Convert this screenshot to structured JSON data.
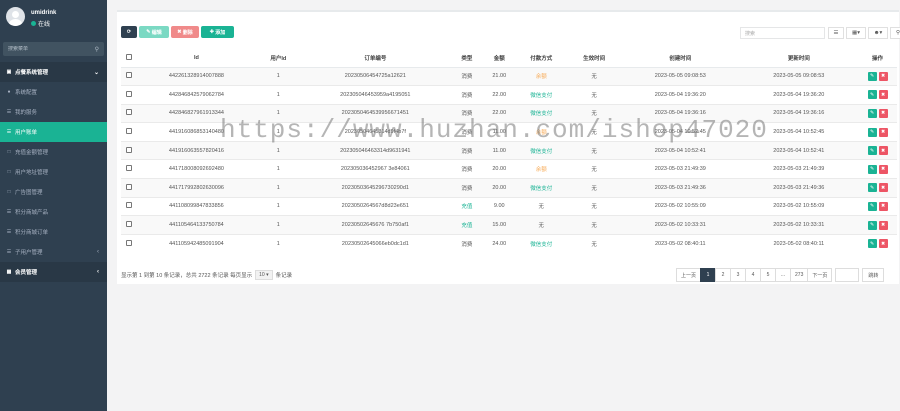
{
  "user": {
    "name": "umidrink",
    "status": "在线"
  },
  "sidebar": {
    "search_placeholder": "搜索菜单",
    "section_title": "点餐系统管理",
    "items": [
      {
        "label": "系统配置",
        "icon": "circle-icon"
      },
      {
        "label": "我的服务",
        "icon": "list-icon"
      },
      {
        "label": "用户账单",
        "icon": "list-icon",
        "active": true
      },
      {
        "label": "充值金额管理",
        "icon": "box-icon"
      },
      {
        "label": "用户地址管理",
        "icon": "box-icon"
      },
      {
        "label": "广告图管理",
        "icon": "box-icon"
      },
      {
        "label": "积分商城产品",
        "icon": "list-icon"
      },
      {
        "label": "积分商城订单",
        "icon": "list-icon"
      },
      {
        "label": "子用户管理",
        "icon": "list-icon"
      }
    ],
    "section2_title": "会员管理"
  },
  "toolbar": {
    "refresh_icon": "refresh-icon",
    "edit_label": "编辑",
    "delete_label": "删除",
    "add_label": "添加"
  },
  "search": {
    "placeholder": "搜索"
  },
  "table": {
    "headers": [
      "Id",
      "用户Id",
      "订单编号",
      "类型",
      "金额",
      "付款方式",
      "生效时间",
      "创建时间",
      "更新时间",
      "操作"
    ],
    "rows": [
      [
        "442261328914007888",
        "1",
        "20230506454725a12621",
        "消费",
        "21.00",
        "余额",
        "无",
        "2023-05-05 09:08:53",
        "2023-05-05 09:08:53"
      ],
      [
        "442846842579062784",
        "1",
        "202305046453959a4195051",
        "消费",
        "22.00",
        "微信支付",
        "无",
        "2023-05-04 19:36:20",
        "2023-05-04 19:36:20"
      ],
      [
        "442846827961913344",
        "1",
        "2023050464539956671451",
        "消费",
        "22.00",
        "微信支付",
        "无",
        "2023-05-04 19:36:16",
        "2023-05-04 19:36:16"
      ],
      [
        "441916086853140480",
        "1",
        "20230504645314d9f4b7f",
        "消费",
        "11.00",
        "余额",
        "无",
        "2023-05-04 10:52:45",
        "2023-05-04 10:52:45"
      ],
      [
        "441916063557820416",
        "1",
        "202305046463314d9631941",
        "消费",
        "11.00",
        "微信支付",
        "无",
        "2023-05-04 10:52:41",
        "2023-05-04 10:52:41"
      ],
      [
        "441718008092692480",
        "1",
        "202305036452967 3e84061",
        "消费",
        "20.00",
        "余额",
        "无",
        "2023-05-03 21:49:39",
        "2023-05-03 21:49:39"
      ],
      [
        "441717992802630096",
        "1",
        "20230503645296730290d1",
        "消费",
        "20.00",
        "微信支付",
        "无",
        "2023-05-03 21:49:36",
        "2023-05-03 21:49:36"
      ],
      [
        "441108099847833856",
        "1",
        "2023050264567d8d23e651",
        "充值",
        "9.00",
        "无",
        "无",
        "2023-05-02 10:55:09",
        "2023-05-02 10:55:09"
      ],
      [
        "441105464133750784",
        "1",
        "20230502645676 7b750af1",
        "充值",
        "15.00",
        "无",
        "无",
        "2023-05-02 10:33:31",
        "2023-05-02 10:33:31"
      ],
      [
        "441105942485091904",
        "1",
        "20230502645066eb0dc1d1",
        "消费",
        "24.00",
        "微信支付",
        "无",
        "2023-05-02 08:40:11",
        "2023-05-02 08:40:11"
      ]
    ]
  },
  "footer": {
    "info_prefix": "显示第 1 到第 10 条记录，总共 2722 条记录 每页显示",
    "page_size": "10",
    "info_suffix": "条记录"
  },
  "pagination": {
    "prev": "上一页",
    "pages": [
      "1",
      "2",
      "3",
      "4",
      "5",
      "...",
      "273"
    ],
    "next": "下一页",
    "jump": "跳转"
  },
  "watermark": "https://www.huzhan.com/ishop47020",
  "colors": {
    "sidebar": "#2f4050",
    "accent": "#1ab394",
    "danger": "#ed5565",
    "warning": "#f8ac59"
  }
}
